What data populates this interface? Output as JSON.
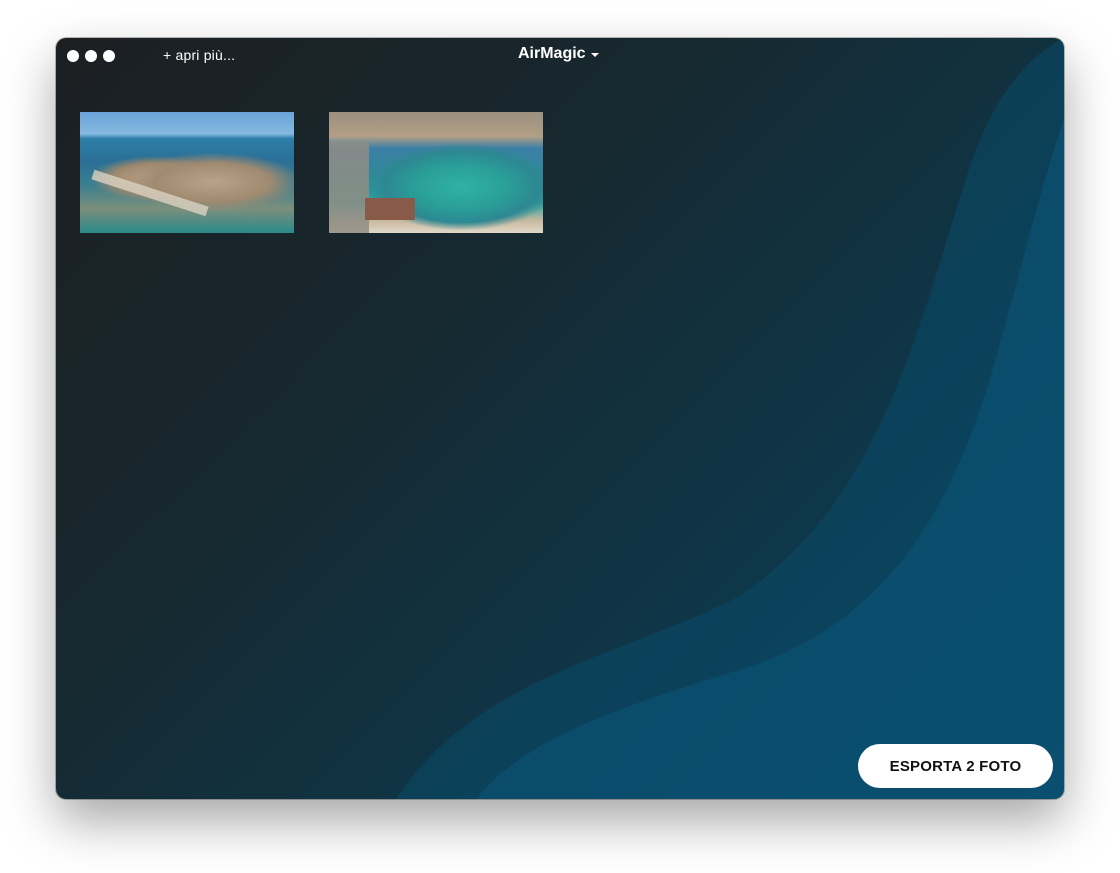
{
  "window": {
    "title": "AirMagic",
    "title_menu_icon": "chevron-down-icon",
    "open_more_label": "+ apri più..."
  },
  "photos": [
    {
      "description_icon": "photo-thumbnail"
    },
    {
      "description_icon": "photo-thumbnail"
    }
  ],
  "footer": {
    "export_label": "ESPORTA 2 FOTO"
  },
  "colors": {
    "background_dark": "#1c1f22",
    "background_blue": "#0b4461",
    "button_bg": "#ffffff",
    "button_text": "#111111"
  }
}
